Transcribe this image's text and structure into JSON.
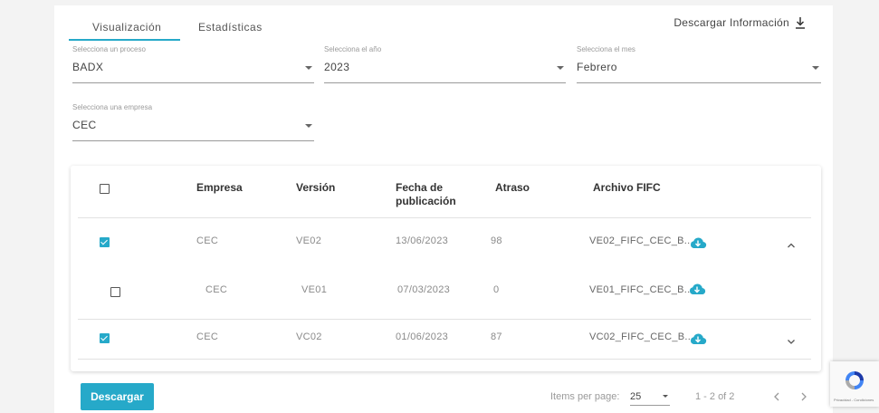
{
  "tabs": [
    {
      "label": "Visualización",
      "active": true
    },
    {
      "label": "Estadísticas",
      "active": false
    }
  ],
  "download_info": {
    "label": "Descargar Información",
    "icon": "download-icon"
  },
  "filters": {
    "proceso": {
      "label": "Selecciona un proceso",
      "value": "BADX"
    },
    "anio": {
      "label": "Selecciona el año",
      "value": "2023"
    },
    "mes": {
      "label": "Selecciona el mes",
      "value": "Febrero"
    },
    "empresa": {
      "label": "Selecciona una empresa",
      "value": "CEC"
    }
  },
  "table": {
    "headers": {
      "empresa": "Empresa",
      "version": "Versión",
      "fecha": "Fecha de publicación",
      "fecha_l1": "Fecha de",
      "fecha_l2": "publicación",
      "atraso": "Atraso",
      "archivo": "Archivo FIFC"
    },
    "rows": [
      {
        "checked": true,
        "empresa": "CEC",
        "version": "VE02",
        "fecha": "13/06/2023",
        "atraso": "98",
        "archivo": "VE02_FIFC_CEC_B...",
        "toggle": "chevron-up-icon"
      },
      {
        "checked": false,
        "empresa": "CEC",
        "version": "VE01",
        "fecha": "07/03/2023",
        "atraso": "0",
        "archivo": "VE01_FIFC_CEC_B...",
        "nested": true
      },
      {
        "checked": true,
        "empresa": "CEC",
        "version": "VC02",
        "fecha": "01/06/2023",
        "atraso": "87",
        "archivo": "VC02_FIFC_CEC_B...",
        "toggle": "chevron-down-icon"
      }
    ]
  },
  "footer": {
    "download_button": "Descargar",
    "items_per_page_label": "Items per page:",
    "items_per_page_value": "25",
    "range": "1 - 2 of 2"
  },
  "recaptcha": {
    "text": "Privacidad - Condiciones"
  },
  "colors": {
    "accent": "#26a9c9",
    "cloud": "#26a9c9"
  }
}
